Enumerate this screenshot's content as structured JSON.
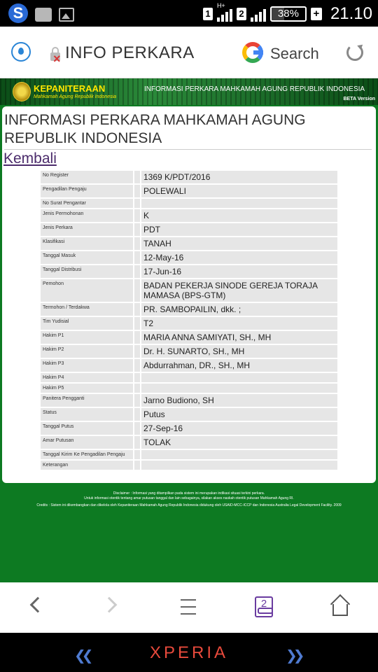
{
  "status": {
    "sim1": "1",
    "sim2": "2",
    "net": "H+",
    "battery": "38%",
    "plus": "+",
    "clock": "21.10"
  },
  "browser": {
    "url_title": "INFO PERKARA",
    "search_label": "Search"
  },
  "banner": {
    "title": "KEPANITERAAN",
    "subtitle": "Mahkamah Agung Republik Indonesia",
    "right_text": "INFORMASI PERKARA MAHKAMAH AGUNG REPUBLIK INDONESIA",
    "beta": "BETA Version"
  },
  "page": {
    "title": "INFORMASI PERKARA MAHKAMAH AGUNG REPUBLIK INDONESIA",
    "back": "Kembali"
  },
  "rows": [
    {
      "label": "No Register",
      "value": "1369 K/PDT/2016"
    },
    {
      "label": "Pengadilan Pengaju",
      "value": "POLEWALI"
    },
    {
      "label": "No Surat Pengantar",
      "value": ""
    },
    {
      "label": "Jenis Permohonan",
      "value": "K"
    },
    {
      "label": "Jenis Perkara",
      "value": "PDT"
    },
    {
      "label": "Klasifikasi",
      "value": "TANAH"
    },
    {
      "label": "Tanggal Masuk",
      "value": "12-May-16"
    },
    {
      "label": "Tanggal Distribusi",
      "value": "17-Jun-16"
    },
    {
      "label": "Pemohon",
      "value": "BADAN PEKERJA SINODE GEREJA TORAJA MAMASA (BPS-GTM)"
    },
    {
      "label": "Termohon / Terdakwa",
      "value": "PR. SAMBOPAILIN, dkk. ;"
    },
    {
      "label": "Tim Yudisial",
      "value": "T2"
    },
    {
      "label": "Hakim P1",
      "value": "MARIA ANNA SAMIYATI, SH., MH"
    },
    {
      "label": "Hakim P2",
      "value": "Dr. H. SUNARTO, SH., MH"
    },
    {
      "label": "Hakim P3",
      "value": "Abdurrahman, DR., SH., MH"
    },
    {
      "label": "Hakim P4",
      "value": ""
    },
    {
      "label": "Hakim P5",
      "value": ""
    },
    {
      "label": "Panitera Pengganti",
      "value": "Jarno Budiono, SH"
    },
    {
      "label": "Status",
      "value": "Putus"
    },
    {
      "label": "Tanggal Putus",
      "value": "27-Sep-16"
    },
    {
      "label": "Amar Putusan",
      "value": "TOLAK"
    },
    {
      "label": "Tanggal Kirim Ke Pengadilan Pengaju",
      "value": ""
    },
    {
      "label": "Keterangan",
      "value": ""
    }
  ],
  "disclaimer": {
    "line1": "Disclaimer : Informasi yang ditampilkan pada sistem ini merupakan indikasi situasi terkini perkara.",
    "line2": "Untuk informasi otentik tentang amar putusan tanggal dan lain sebagainya, silakan akses naskah otentik putusan Mahkamah Agung RI.",
    "line3": "Credits : Sistem ini dikembangkan dan dikelola oleh Kepaniteraan Mahkamah Agung Republik Indonesia didukung oleh USAID-MCC-ICCP dan Indonesia Australia Legal Development Facility. 2009"
  },
  "nav": {
    "tabs_count": "2"
  },
  "system": {
    "brand": "XPERIA"
  },
  "colors": {
    "page_green": "#0d7a22",
    "banner_yellow": "#ffe600",
    "link_purple": "#4b2b6b",
    "brand_red": "#e84a3c"
  }
}
